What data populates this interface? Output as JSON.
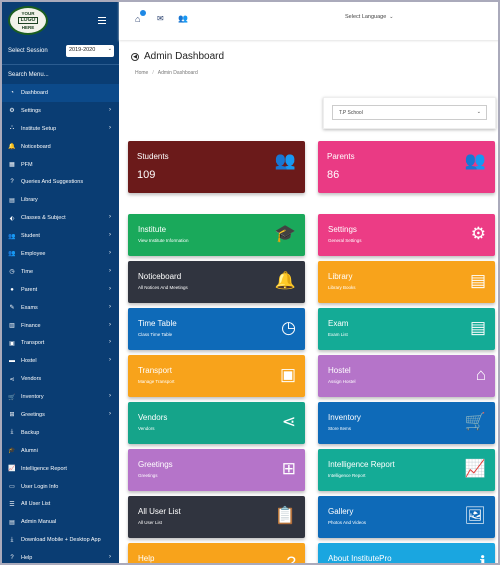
{
  "sidebar": {
    "logo_lines": [
      "YOUR",
      "LOGO",
      "HERE"
    ],
    "session_label": "Select Session",
    "session_value": "2019-2020",
    "search_placeholder": "Search Menu...",
    "items": [
      {
        "label": "Dashboard",
        "icon": "dashboard-icon",
        "chevron": false
      },
      {
        "label": "Settings",
        "icon": "gears-icon",
        "chevron": true
      },
      {
        "label": "Institute Setup",
        "icon": "sitemap-icon",
        "chevron": true
      },
      {
        "label": "Noticeboard",
        "icon": "bell-icon",
        "chevron": false
      },
      {
        "label": "PFM",
        "icon": "calendar-icon",
        "chevron": false
      },
      {
        "label": "Queries And Suggestions",
        "icon": "question-icon",
        "chevron": false
      },
      {
        "label": "Library",
        "icon": "book-icon",
        "chevron": false
      },
      {
        "label": "Classes & Subject",
        "icon": "tag-icon",
        "chevron": true
      },
      {
        "label": "Student",
        "icon": "users-icon",
        "chevron": true
      },
      {
        "label": "Employee",
        "icon": "users-icon",
        "chevron": true
      },
      {
        "label": "Time",
        "icon": "clock-icon",
        "chevron": true
      },
      {
        "label": "Parent",
        "icon": "user-icon",
        "chevron": true
      },
      {
        "label": "Exams",
        "icon": "pencil-icon",
        "chevron": true
      },
      {
        "label": "Finance",
        "icon": "bank-icon",
        "chevron": true
      },
      {
        "label": "Transport",
        "icon": "bus-icon",
        "chevron": true
      },
      {
        "label": "Hostel",
        "icon": "bed-icon",
        "chevron": true
      },
      {
        "label": "Vendors",
        "icon": "share-icon",
        "chevron": false
      },
      {
        "label": "Inventory",
        "icon": "cart-icon",
        "chevron": true
      },
      {
        "label": "Greetings",
        "icon": "gift-icon",
        "chevron": true
      },
      {
        "label": "Backup",
        "icon": "download-icon",
        "chevron": false
      },
      {
        "label": "Alumni",
        "icon": "graduation-icon",
        "chevron": false
      },
      {
        "label": "Intelligence Report",
        "icon": "chart-icon",
        "chevron": false
      },
      {
        "label": "User Login Info",
        "icon": "idcard-icon",
        "chevron": false
      },
      {
        "label": "All User List",
        "icon": "list-icon",
        "chevron": false
      },
      {
        "label": "Admin Manual",
        "icon": "manual-icon",
        "chevron": false
      },
      {
        "label": "Download Mobile + Desktop App",
        "icon": "download-icon",
        "chevron": false
      },
      {
        "label": "Help",
        "icon": "help-icon",
        "chevron": true
      }
    ]
  },
  "topbar": {
    "language_placeholder": "Select Language"
  },
  "page": {
    "title": "Admin Dashboard",
    "breadcrumb": [
      "Home",
      "Admin Dashboard"
    ],
    "school": "T.P School"
  },
  "stats": [
    {
      "title": "Students",
      "value": "109",
      "color": "#6b1a1a",
      "icon": "users-icon"
    },
    {
      "title": "Parents",
      "value": "86",
      "color": "#ea3a84",
      "icon": "users-icon"
    }
  ],
  "cards": [
    {
      "title": "Institute",
      "subtitle": "View Institute Information",
      "color": "#1aa95b",
      "icon": "graduation-icon"
    },
    {
      "title": "Settings",
      "subtitle": "General Settings",
      "color": "#ec3c85",
      "icon": "gear-icon"
    },
    {
      "title": "Noticeboard",
      "subtitle": "All Notices And Meetings",
      "color": "#30343f",
      "icon": "bell-icon"
    },
    {
      "title": "Library",
      "subtitle": "Library Books",
      "color": "#f8a31b",
      "icon": "book-icon"
    },
    {
      "title": "Time Table",
      "subtitle": "Class Time Table",
      "color": "#0e6ab8",
      "icon": "clock-icon"
    },
    {
      "title": "Exam",
      "subtitle": "Exam List",
      "color": "#14ab96",
      "icon": "book-icon"
    },
    {
      "title": "Transport",
      "subtitle": "Manage Transport",
      "color": "#f8a31b",
      "icon": "bus-icon"
    },
    {
      "title": "Hostel",
      "subtitle": "Assign Hostel",
      "color": "#b574c9",
      "icon": "home-icon"
    },
    {
      "title": "Vendors",
      "subtitle": "Vendors",
      "color": "#15a48a",
      "icon": "share-icon"
    },
    {
      "title": "Inventory",
      "subtitle": "Store Items",
      "color": "#0e6ab8",
      "icon": "cart-icon"
    },
    {
      "title": "Greetings",
      "subtitle": "Greetings",
      "color": "#b574c9",
      "icon": "gift-icon"
    },
    {
      "title": "Intelligence Report",
      "subtitle": "Intelligence Report",
      "color": "#14ab96",
      "icon": "chart-icon"
    },
    {
      "title": "All User List",
      "subtitle": "All User List",
      "color": "#30343f",
      "icon": "clipboard-icon"
    },
    {
      "title": "Gallery",
      "subtitle": "Photos And Videos",
      "color": "#0e6ab8",
      "icon": "image-icon"
    },
    {
      "title": "Help",
      "subtitle": "",
      "color": "#f8a31b",
      "icon": "help-icon"
    },
    {
      "title": "About InstitutePro",
      "subtitle": "",
      "color": "#1aa6e0",
      "icon": "info-icon"
    }
  ]
}
